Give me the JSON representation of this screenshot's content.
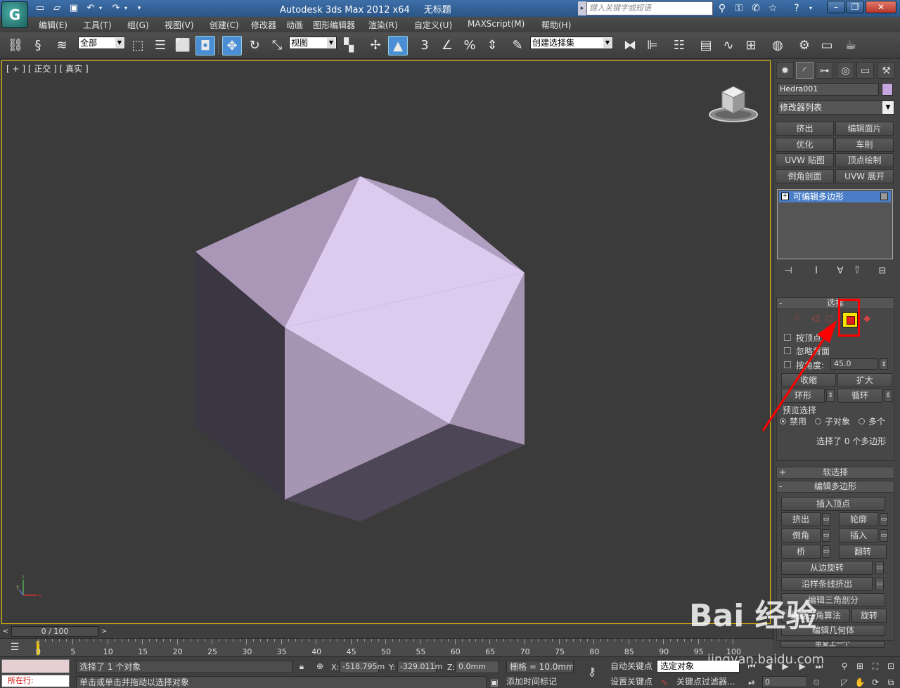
{
  "title": {
    "app": "Autodesk 3ds Max  2012 x64",
    "doc": "无标题",
    "search_placeholder": "键入关键字或短语"
  },
  "menu": [
    "编辑(E)",
    "工具(T)",
    "组(G)",
    "视图(V)",
    "创建(C)",
    "修改器",
    "动画",
    "图形编辑器",
    "渲染(R)",
    "自定义(U)",
    "MAXScript(M)",
    "帮助(H)"
  ],
  "toolbar": {
    "filter_value": "全部",
    "refcoord_value": "视图",
    "named_selection_value": "创建选择集"
  },
  "viewport": {
    "label": "[ + ] [ 正交 ] [ 真实 ]"
  },
  "panel": {
    "object_name": "Hedra001",
    "object_color": "#c6a6e0",
    "modifier_list": "修改器列表",
    "modifier_buttons": [
      "挤出",
      "编辑面片",
      "优化",
      "车削",
      "UVW 贴图",
      "顶点绘制",
      "倒角剖面",
      "UVW 展开"
    ],
    "stack_item": "可编辑多边形",
    "selection": {
      "title": "选择",
      "by_vertex": "按顶点",
      "ignore_backface": "忽略背面",
      "by_angle": "按角度:",
      "angle_value": "45.0",
      "shrink": "收缩",
      "grow": "扩大",
      "ring": "环形",
      "loop": "循环",
      "preview_title": "预览选择",
      "preview_off": "禁用",
      "preview_sub": "子对象",
      "preview_multi": "多个",
      "status": "选择了 0 个多边形"
    },
    "soft_selection": "软选择",
    "edit_polygons": {
      "title": "编辑多边形",
      "insert_vertex": "插入顶点",
      "extrude": "挤出",
      "outline": "轮廓",
      "bevel": "倒角",
      "inset": "插入",
      "bridge": "桥",
      "flip": "翻转",
      "hinge": "从边旋转",
      "extrude_spline": "沿样条线挤出",
      "edit_tri": "编辑三角剖分",
      "retriangulate": "重复三角算法",
      "turn": "旋转",
      "edit_geo": "编辑几何体",
      "repeat_last": "重复上一个"
    }
  },
  "timeline": {
    "frame_display": "0 / 100",
    "ticks": [
      "0",
      "5",
      "10",
      "15",
      "20",
      "25",
      "30",
      "35",
      "40",
      "45",
      "50",
      "55",
      "60",
      "65",
      "70",
      "75",
      "80",
      "85",
      "90",
      "95",
      "100"
    ]
  },
  "status": {
    "script_label": "所在行:",
    "selected": "选择了 1 个对象",
    "prompt": "单击或单击并拖动以选择对象",
    "x_label": "X:",
    "x_value": "-518.795m",
    "y_label": "Y:",
    "y_value": "-329.011m",
    "z_label": "Z:",
    "z_value": "0.0mm",
    "grid": "栅格 = 10.0mm",
    "add_time_tag": "添加时间标记",
    "auto_key": "自动关键点",
    "set_key": "设置关键点",
    "selected_object": "选定对象",
    "key_filters": "关键点过滤器...",
    "frame_value": "0"
  },
  "watermark": {
    "main": "Bai 经验",
    "url": "jingyan.baidu.com"
  }
}
